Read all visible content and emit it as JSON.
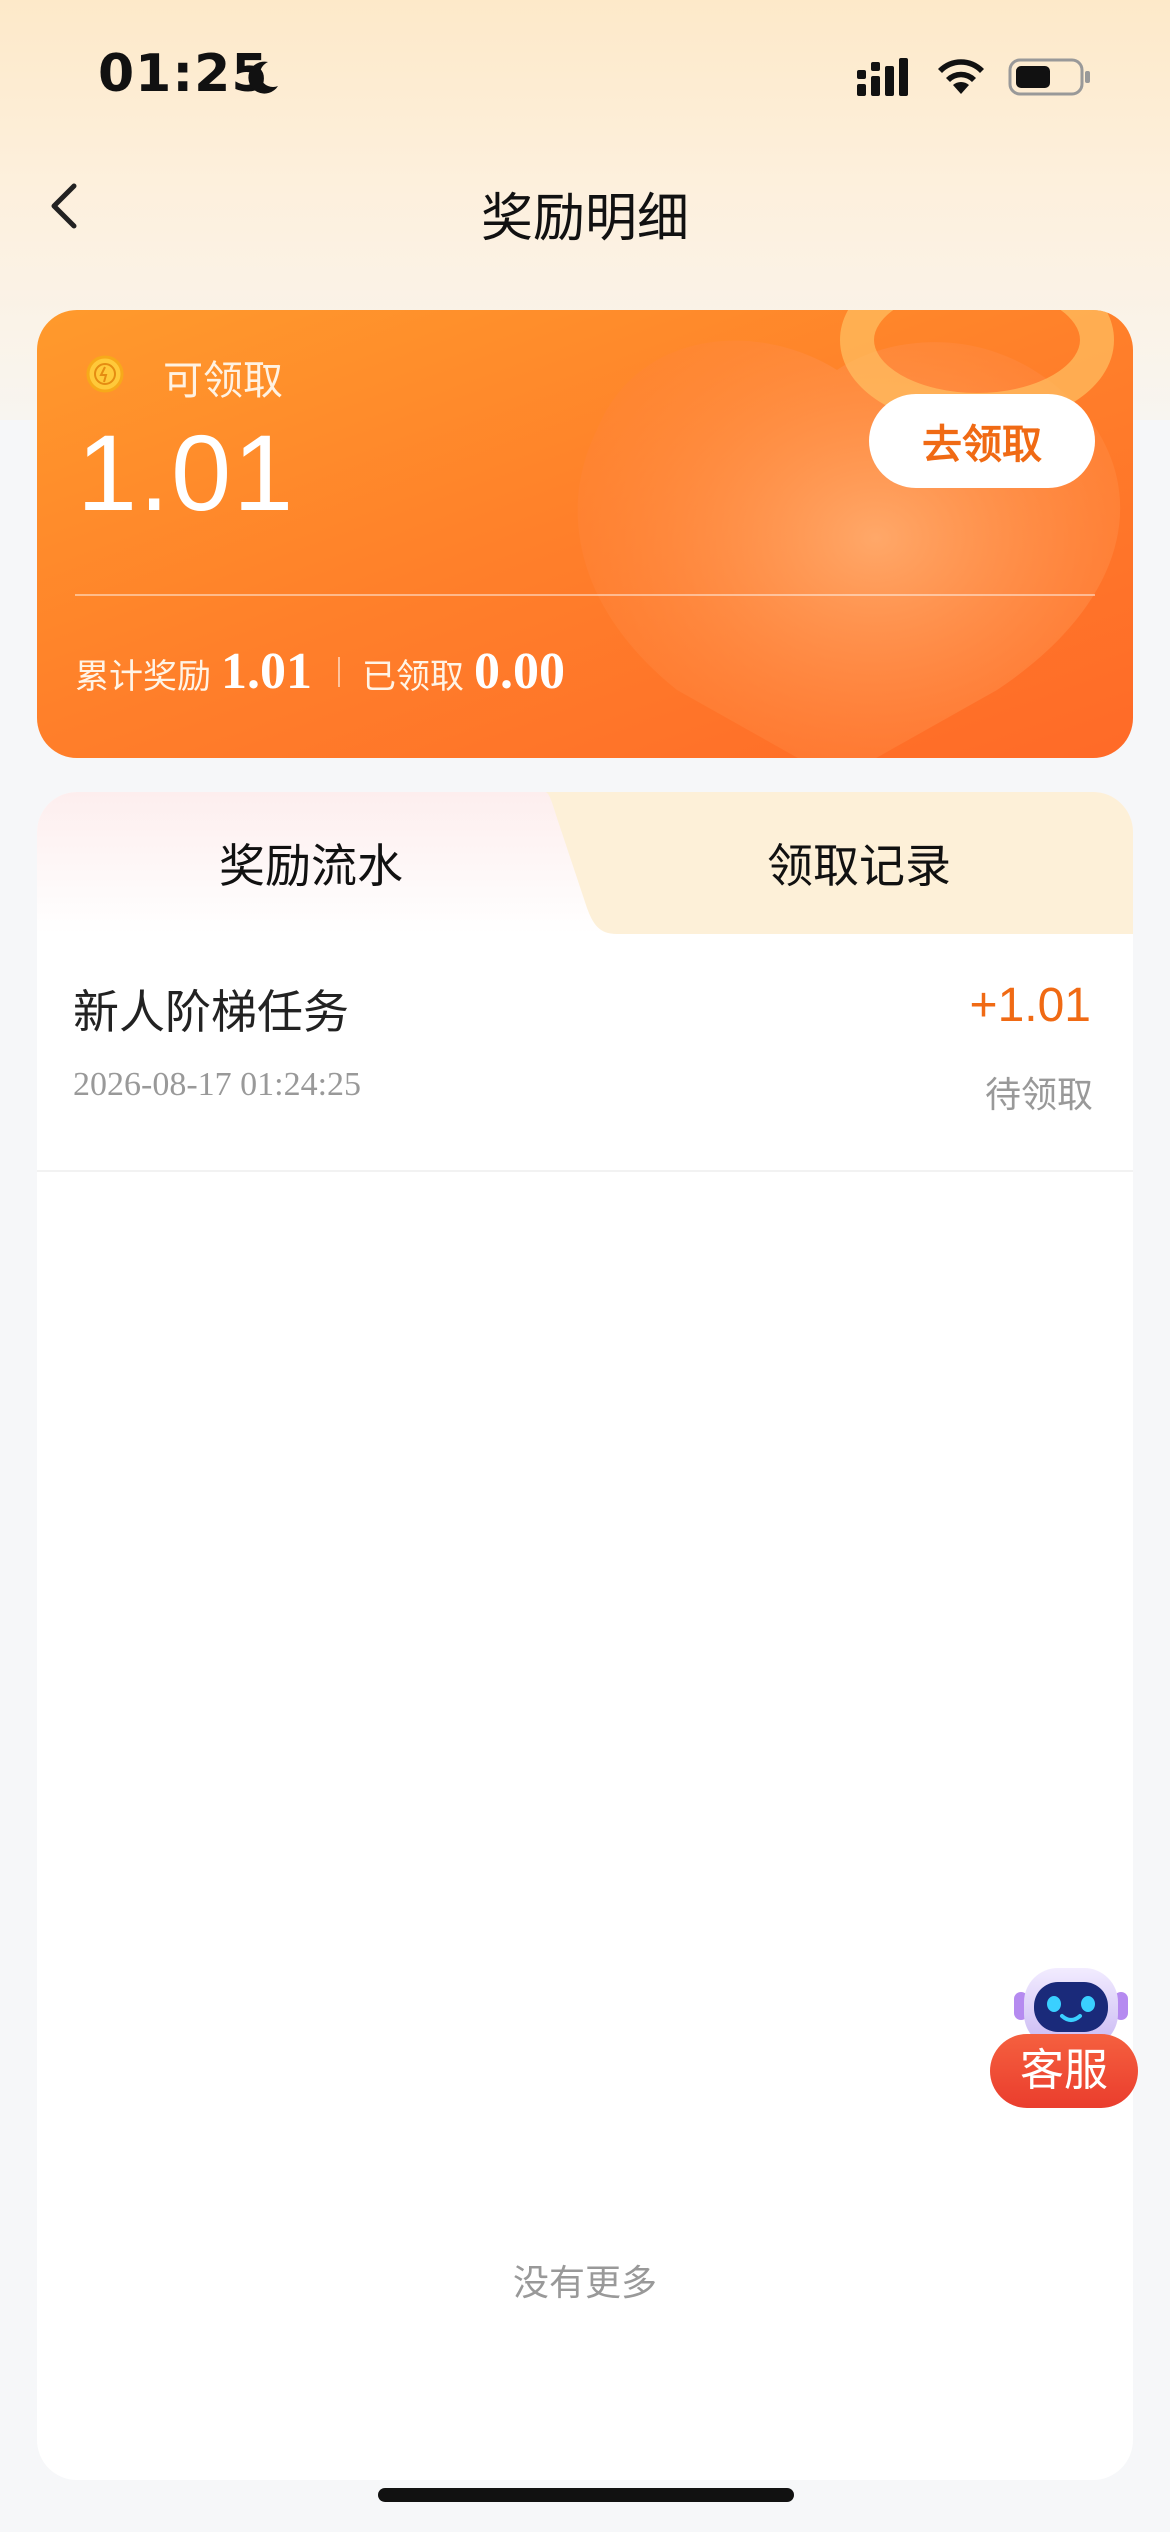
{
  "status_bar": {
    "time": "01:25"
  },
  "nav": {
    "title": "奖励明细"
  },
  "card": {
    "claimable_label": "可领取",
    "claimable_amount": "1.01",
    "claim_button": "去领取",
    "total_label": "累计奖励",
    "total_value": "1.01",
    "claimed_label": "已领取",
    "claimed_value": "0.00"
  },
  "tabs": [
    {
      "label": "奖励流水",
      "active": true
    },
    {
      "label": "领取记录",
      "active": false
    }
  ],
  "records": [
    {
      "title": "新人阶梯任务",
      "date": "2026-08-17 01:24:25",
      "amount": "+1.01",
      "status": "待领取"
    }
  ],
  "list_footer": "没有更多",
  "service": {
    "label": "客服"
  },
  "colors": {
    "accent": "#f06a14",
    "card_start": "#ff9a2c",
    "card_end": "#ff6a28",
    "tab_inactive_bg": "#fdf0d8",
    "service_red": "#ea3d2d"
  }
}
